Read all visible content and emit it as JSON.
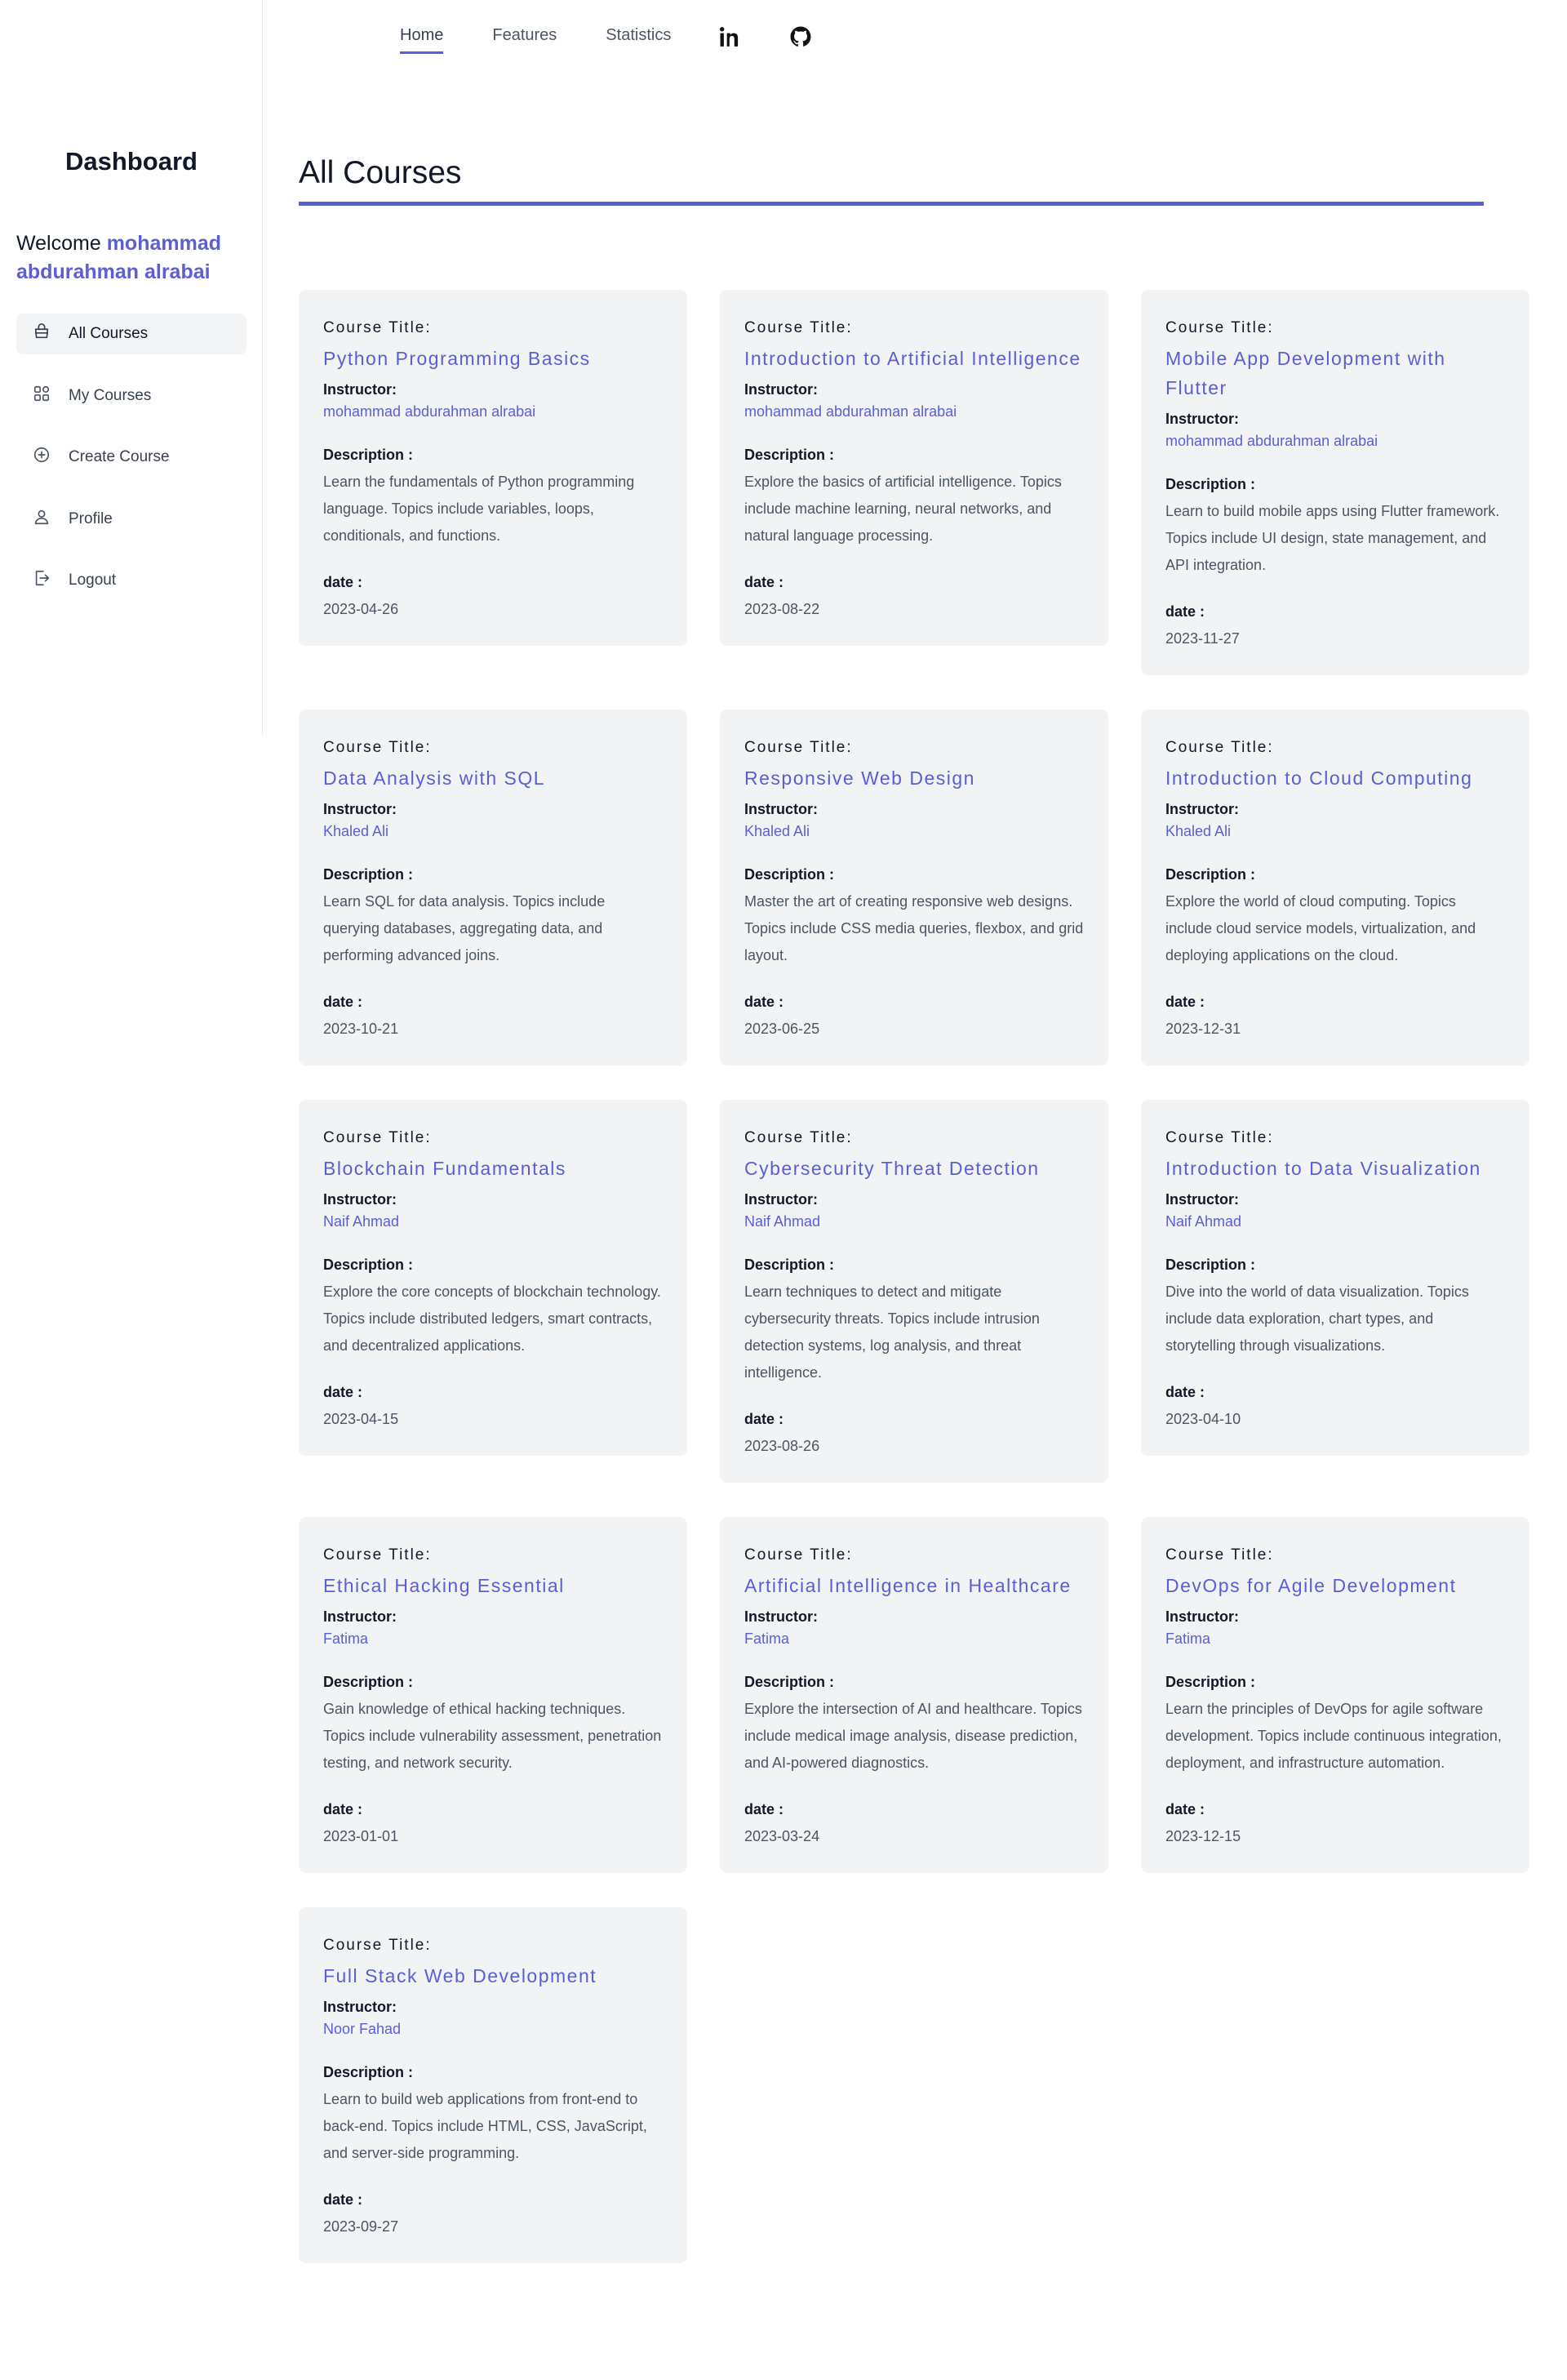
{
  "nav": {
    "links": [
      {
        "label": "Home",
        "active": true
      },
      {
        "label": "Features",
        "active": false
      },
      {
        "label": "Statistics",
        "active": false
      }
    ],
    "icons": [
      "linkedin-icon",
      "github-icon"
    ]
  },
  "sidebar": {
    "title": "Dashboard",
    "welcome_prefix": "Welcome",
    "username": "mohammad abdurahman alrabai",
    "items": [
      {
        "label": "All Courses",
        "icon": "bag-icon",
        "active": true
      },
      {
        "label": "My Courses",
        "icon": "grid-icon",
        "active": false
      },
      {
        "label": "Create Course",
        "icon": "plus-circle-icon",
        "active": false
      },
      {
        "label": "Profile",
        "icon": "user-icon",
        "active": false
      },
      {
        "label": "Logout",
        "icon": "logout-icon",
        "active": false
      }
    ]
  },
  "main": {
    "title": "All Courses",
    "labels": {
      "course_title": "Course Title:",
      "instructor": "Instructor:",
      "description": "Description :",
      "date": "date :"
    },
    "courses": [
      {
        "title": "Python Programming Basics",
        "instructor": "mohammad abdurahman alrabai",
        "description": "Learn the fundamentals of Python programming language. Topics include variables, loops, conditionals, and functions.",
        "date": "2023-04-26"
      },
      {
        "title": "Introduction to Artificial Intelligence",
        "instructor": "mohammad abdurahman alrabai",
        "description": "Explore the basics of artificial intelligence. Topics include machine learning, neural networks, and natural language processing.",
        "date": "2023-08-22"
      },
      {
        "title": "Mobile App Development with Flutter",
        "instructor": "mohammad abdurahman alrabai",
        "description": "Learn to build mobile apps using Flutter framework. Topics include UI design, state management, and API integration.",
        "date": "2023-11-27"
      },
      {
        "title": "Data Analysis with SQL",
        "instructor": "Khaled Ali",
        "description": "Learn SQL for data analysis. Topics include querying databases, aggregating data, and performing advanced joins.",
        "date": "2023-10-21"
      },
      {
        "title": "Responsive Web Design",
        "instructor": "Khaled Ali",
        "description": "Master the art of creating responsive web designs. Topics include CSS media queries, flexbox, and grid layout.",
        "date": "2023-06-25"
      },
      {
        "title": "Introduction to Cloud Computing",
        "instructor": "Khaled Ali",
        "description": "Explore the world of cloud computing. Topics include cloud service models, virtualization, and deploying applications on the cloud.",
        "date": "2023-12-31"
      },
      {
        "title": "Blockchain Fundamentals",
        "instructor": "Naif Ahmad",
        "description": "Explore the core concepts of blockchain technology. Topics include distributed ledgers, smart contracts, and decentralized applications.",
        "date": "2023-04-15"
      },
      {
        "title": "Cybersecurity Threat Detection",
        "instructor": "Naif Ahmad",
        "description": "Learn techniques to detect and mitigate cybersecurity threats. Topics include intrusion detection systems, log analysis, and threat intelligence.",
        "date": "2023-08-26"
      },
      {
        "title": "Introduction to Data Visualization",
        "instructor": "Naif Ahmad",
        "description": "Dive into the world of data visualization. Topics include data exploration, chart types, and storytelling through visualizations.",
        "date": "2023-04-10"
      },
      {
        "title": "Ethical Hacking Essential",
        "instructor": "Fatima",
        "description": "Gain knowledge of ethical hacking techniques. Topics include vulnerability assessment, penetration testing, and network security.",
        "date": "2023-01-01"
      },
      {
        "title": "Artificial Intelligence in Healthcare",
        "instructor": "Fatima",
        "description": "Explore the intersection of AI and healthcare. Topics include medical image analysis, disease prediction, and AI-powered diagnostics.",
        "date": "2023-03-24"
      },
      {
        "title": "DevOps for Agile Development",
        "instructor": "Fatima",
        "description": "Learn the principles of DevOps for agile software development. Topics include continuous integration, deployment, and infrastructure automation.",
        "date": "2023-12-15"
      },
      {
        "title": "Full Stack Web Development",
        "instructor": "Noor Fahad",
        "description": "Learn to build web applications from front-end to back-end. Topics include HTML, CSS, JavaScript, and server-side programming.",
        "date": "2023-09-27"
      }
    ]
  }
}
